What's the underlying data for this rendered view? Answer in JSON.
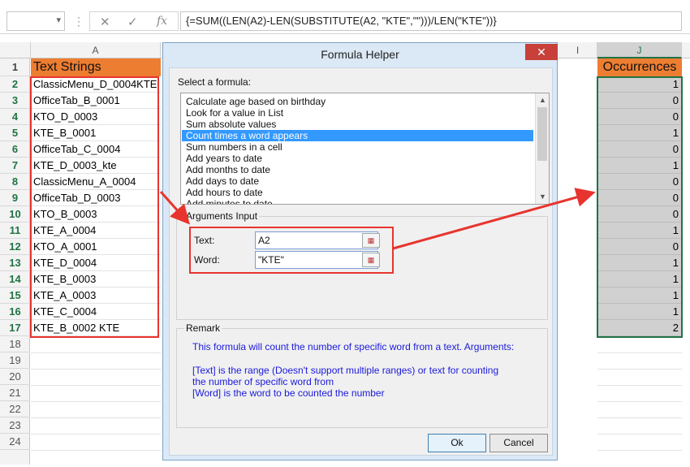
{
  "formula_bar": {
    "name_box": "",
    "cancel_icon": "✕",
    "enter_icon": "✓",
    "fx_label": "fx",
    "formula": "{=SUM((LEN(A2)-LEN(SUBSTITUTE(A2, \"KTE\",\"\")))/LEN(\"KTE\"))}"
  },
  "sheet": {
    "columns": [
      "A",
      "I",
      "J"
    ],
    "rows": [
      "1",
      "2",
      "3",
      "4",
      "5",
      "6",
      "7",
      "8",
      "9",
      "10",
      "11",
      "12",
      "13",
      "14",
      "15",
      "16",
      "17",
      "18",
      "19",
      "20",
      "21",
      "22",
      "23",
      "24"
    ],
    "header_a": "Text Strings",
    "header_j": "Occurrences",
    "col_a": [
      "ClassicMenu_D_0004KTE",
      "OfficeTab_B_0001",
      "KTO_D_0003",
      "KTE_B_0001",
      "OfficeTab_C_0004",
      "KTE_D_0003_kte",
      "ClassicMenu_A_0004",
      "OfficeTab_D_0003",
      "KTO_B_0003",
      "KTE_A_0004",
      "KTO_A_0001",
      "KTE_D_0004",
      "KTE_B_0003",
      "KTE_A_0003",
      "KTE_C_0004",
      "KTE_B_0002 KTE"
    ],
    "col_j": [
      "1",
      "0",
      "0",
      "1",
      "0",
      "1",
      "0",
      "0",
      "0",
      "1",
      "0",
      "1",
      "1",
      "1",
      "1",
      "2"
    ]
  },
  "dialog": {
    "title": "Formula Helper",
    "close": "✕",
    "select_label": "Select a formula:",
    "formulas": [
      "Calculate age based on birthday",
      "Look for a value in List",
      "Sum absolute values",
      "Count times a word appears",
      "Sum numbers in a cell",
      "Add years to date",
      "Add months to date",
      "Add days to date",
      "Add hours to date",
      "Add minutes to date"
    ],
    "selected_index": 3,
    "args_title": "Arguments Input",
    "text_label": "Text:",
    "text_value": "A2",
    "word_label": "Word:",
    "word_value": "\"KTE\"",
    "remark_title": "Remark",
    "remark_1": "This formula will count the number of specific word from a text. Arguments:",
    "remark_2": "[Text] is the range (Doesn't support multiple ranges) or text for counting",
    "remark_3": "the number of specific word from",
    "remark_4": "[Word] is the word to be counted the number",
    "ok": "Ok",
    "cancel": "Cancel"
  },
  "colors": {
    "header_fill": "#ed7d31",
    "highlight_red": "#e8342e",
    "selection_green": "#217346",
    "list_selection": "#3399ff",
    "remark_text": "#1a1adb"
  }
}
